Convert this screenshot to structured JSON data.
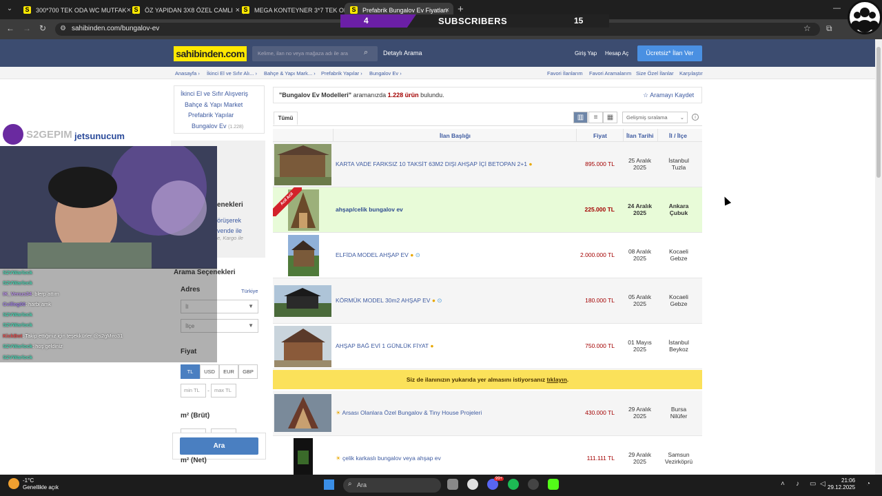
{
  "browser": {
    "tabs": [
      {
        "title": "300*700 TEK ODA WC MUTFAK",
        "active": false
      },
      {
        "title": "ÖZ YAPIDAN 3X8 ÖZEL CAMLI",
        "active": false
      },
      {
        "title": "MEGA KONTEYNER 3*7 TEK OD",
        "active": false
      },
      {
        "title": "Prefabrik Bungalov Ev Fiyatları",
        "active": true
      }
    ],
    "url": "sahibinden.com/bungalov-ev"
  },
  "overlay": {
    "count_left": "4",
    "label": "SUBSCRIBERS",
    "count_right": "15",
    "brand1": "S2GEPIM",
    "brand2": "jetsunucum"
  },
  "header": {
    "logo": "sahibinden.com",
    "search_placeholder": "Kelime, ilan no veya mağaza adı ile ara",
    "detail_search": "Detaylı Arama",
    "login": "Giriş Yap",
    "register": "Hesap Aç",
    "post_ad": "Ücretsiz* İlan Ver"
  },
  "breadcrumb": {
    "items": [
      "Anasayfa",
      "İkinci El ve Sıfır Alı...",
      "Bahçe & Yapı Mark...",
      "Prefabrik Yapılar",
      "Bungalov Ev"
    ],
    "right": [
      "Favori İlanlarım",
      "Favori Aramalarım",
      "Size Özel İlanlar",
      "Karşılaştır"
    ]
  },
  "sidebar": {
    "categories": [
      {
        "label": "İkinci El ve Sıfır Alışveriş"
      },
      {
        "label": "Bahçe & Yapı Market"
      },
      {
        "label": "Prefabrik Yapılar"
      },
      {
        "label": "Bungalov Ev",
        "count": "(1.228)"
      }
    ],
    "partial": [
      "enekleri",
      "örüşerek",
      "vende ile",
      "e, Kargo ile"
    ],
    "search_options": "Arama Seçenekleri",
    "address_label": "Adres",
    "country": "Türkiye",
    "il": "İl",
    "ilce": "İlçe",
    "price_label": "Fiyat",
    "currencies": [
      "TL",
      "USD",
      "EUR",
      "GBP"
    ],
    "min": "min TL",
    "max": "max TL",
    "m2_label": "m² (Brüt)",
    "m2_net": "m² (Net)",
    "search_button": "Ara"
  },
  "results": {
    "query_prefix": "\"Bungalov Ev Modelleri\"",
    "query_mid": " aramanızda ",
    "count": "1.228 ürün",
    "query_suffix": " bulundu.",
    "save_search": "Aramayı Kaydet",
    "tab_all": "Tümü",
    "sort": "Gelişmiş sıralama",
    "columns": {
      "title": "İlan Başlığı",
      "price": "Fiyat",
      "date": "İlan Tarihi",
      "location": "İl / İlçe"
    },
    "promo_text": "Siz de ilanınızın yukarıda yer almasını istiyorsanız ",
    "promo_link": "tıklayın",
    "promo_end": ".",
    "listings": [
      {
        "title": "KARTA VADE FARKSIZ 10 TAKSİT 63M2 DIŞI AHŞAP İÇİ BETOPAN 2+1",
        "price": "895.000 TL",
        "date1": "25 Aralık",
        "date2": "2025",
        "loc1": "İstanbul",
        "loc2": "Tuzla"
      },
      {
        "title": "ahşap/celik bungalov ev",
        "price": "225.000 TL",
        "date1": "24 Aralık",
        "date2": "2025",
        "loc1": "Ankara",
        "loc2": "Çubuk",
        "badge": "Acil Acil"
      },
      {
        "title": "ELFİDA MODEL AHŞAP EV",
        "price": "2.000.000 TL",
        "date1": "08 Aralık",
        "date2": "2025",
        "loc1": "Kocaeli",
        "loc2": "Gebze"
      },
      {
        "title": "KÖRMÜK MODEL 30m2 AHŞAP EV",
        "price": "180.000 TL",
        "date1": "05 Aralık",
        "date2": "2025",
        "loc1": "Kocaeli",
        "loc2": "Gebze"
      },
      {
        "title": "AHŞAP BAĞ EVİ 1 GÜNLÜK FİYAT",
        "price": "750.000 TL",
        "date1": "01 Mayıs",
        "date2": "2025",
        "loc1": "İstanbul",
        "loc2": "Beykoz"
      },
      {
        "title": "Arsası Olanlara Özel Bungalov & Tiny House Projeleri",
        "price": "430.000 TL",
        "date1": "29 Aralık",
        "date2": "2025",
        "loc1": "Bursa",
        "loc2": "Nilüfer"
      },
      {
        "title": "çelik karkaslı bungalov veya ahşap ev",
        "price": "111.111 TL",
        "date1": "29 Aralık",
        "date2": "2025",
        "loc1": "Samsun",
        "loc2": "Vezirköprü"
      }
    ]
  },
  "chat": [
    {
      "user": "S2VWarlock",
      "msg": ""
    },
    {
      "user": "S2VWarlock",
      "msg": ""
    },
    {
      "user": "IK_Venus34",
      "msg": ": blerp attım"
    },
    {
      "user": "Cvilleg00",
      "msg": ": harbi amk"
    },
    {
      "user": "S2VWarlock",
      "msg": ""
    },
    {
      "user": "S2VWarlock",
      "msg": ""
    },
    {
      "user": "KickBot",
      "msg": ": Takip ettiğiniz için teşekkürler @s2gMiro31"
    },
    {
      "user": "S2VWarlock",
      "msg": ": hoş geldiniz"
    },
    {
      "user": "S2VWarlock",
      "msg": ""
    }
  ],
  "taskbar": {
    "temp": "-1°C",
    "weather": "Genellikle açık",
    "search": "Ara",
    "time": "21:06",
    "date": "29.12.2025",
    "badge": "99+"
  }
}
